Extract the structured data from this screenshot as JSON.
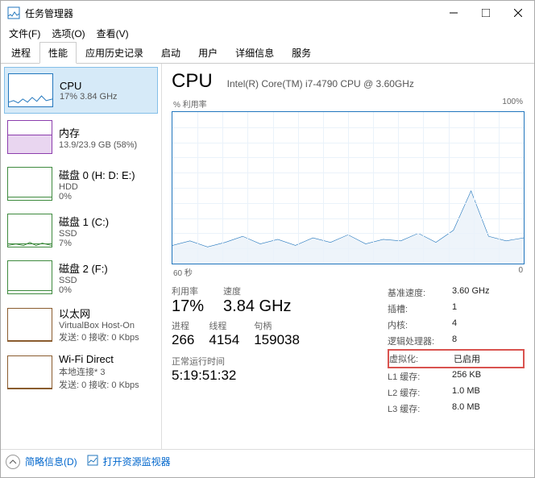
{
  "window": {
    "title": "任务管理器"
  },
  "menu": {
    "file": "文件(F)",
    "options": "选项(O)",
    "view": "查看(V)"
  },
  "tabs": [
    "进程",
    "性能",
    "应用历史记录",
    "启动",
    "用户",
    "详细信息",
    "服务"
  ],
  "activeTab": 1,
  "sidebar": [
    {
      "name": "CPU",
      "sub": "17%  3.84 GHz",
      "kind": "cpu",
      "selected": true
    },
    {
      "name": "内存",
      "sub": "13.9/23.9 GB (58%)",
      "kind": "mem"
    },
    {
      "name": "磁盘 0 (H: D: E:)",
      "sub": "HDD",
      "val": "0%",
      "kind": "disk"
    },
    {
      "name": "磁盘 1 (C:)",
      "sub": "SSD",
      "val": "7%",
      "kind": "disk"
    },
    {
      "name": "磁盘 2 (F:)",
      "sub": "SSD",
      "val": "0%",
      "kind": "disk"
    },
    {
      "name": "以太网",
      "sub": "VirtualBox Host-On",
      "val": "发送: 0 接收: 0 Kbps",
      "kind": "eth"
    },
    {
      "name": "Wi-Fi Direct",
      "sub": "本地连接* 3",
      "val": "发送: 0 接收: 0 Kbps",
      "kind": "wifi"
    }
  ],
  "header": {
    "title": "CPU",
    "model": "Intel(R) Core(TM) i7-4790 CPU @ 3.60GHz"
  },
  "chart": {
    "topLeft": "% 利用率",
    "topRight": "100%",
    "bottomLeft": "60 秒",
    "bottomRight": "0"
  },
  "stats1": [
    {
      "lbl": "利用率",
      "val": "17%"
    },
    {
      "lbl": "速度",
      "val": "3.84 GHz"
    }
  ],
  "stats2": [
    {
      "lbl": "进程",
      "val": "266"
    },
    {
      "lbl": "线程",
      "val": "4154"
    },
    {
      "lbl": "句柄",
      "val": "159038"
    }
  ],
  "uptime": {
    "lbl": "正常运行时间",
    "val": "5:19:51:32"
  },
  "right": [
    {
      "k": "基准速度:",
      "v": "3.60 GHz"
    },
    {
      "k": "插槽:",
      "v": "1"
    },
    {
      "k": "内核:",
      "v": "4"
    },
    {
      "k": "逻辑处理器:",
      "v": "8"
    },
    {
      "k": "虚拟化:",
      "v": "已启用",
      "hl": true
    },
    {
      "k": "L1 缓存:",
      "v": "256 KB"
    },
    {
      "k": "L2 缓存:",
      "v": "1.0 MB"
    },
    {
      "k": "L3 缓存:",
      "v": "8.0 MB"
    }
  ],
  "footer": {
    "less": "简略信息(D)",
    "monitor": "打开资源监视器"
  },
  "chart_data": {
    "type": "line",
    "title": "% 利用率",
    "xlabel": "60 秒",
    "ylabel": "",
    "ylim": [
      0,
      100
    ],
    "x_seconds_ago": [
      60,
      57,
      54,
      51,
      48,
      45,
      42,
      39,
      36,
      33,
      30,
      27,
      24,
      21,
      18,
      15,
      12,
      9,
      6,
      3,
      0
    ],
    "values": [
      12,
      15,
      11,
      14,
      18,
      13,
      16,
      12,
      17,
      14,
      19,
      13,
      16,
      15,
      20,
      14,
      22,
      48,
      18,
      15,
      17
    ]
  }
}
